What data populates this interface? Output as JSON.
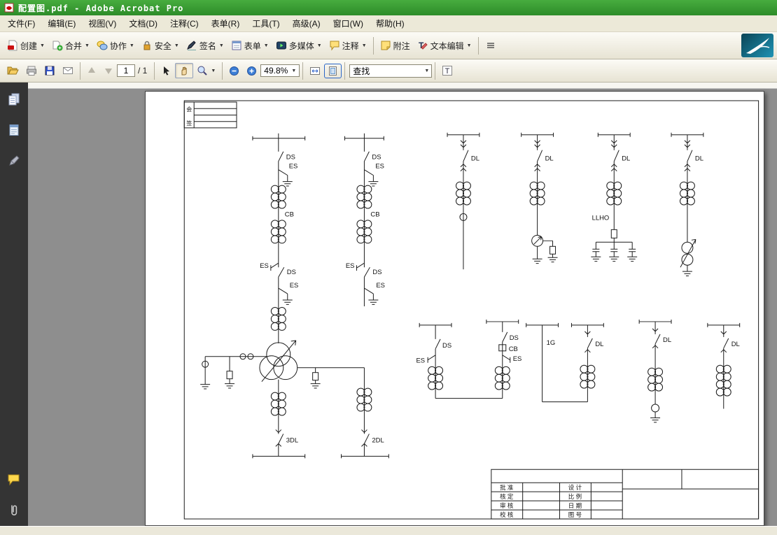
{
  "window": {
    "title": "配置图.pdf - Adobe Acrobat Pro"
  },
  "menubar": {
    "items": [
      "文件(F)",
      "编辑(E)",
      "视图(V)",
      "文档(D)",
      "注释(C)",
      "表单(R)",
      "工具(T)",
      "高级(A)",
      "窗口(W)",
      "帮助(H)"
    ]
  },
  "toolbar_main": {
    "create": "创建",
    "combine": "合并",
    "collaborate": "协作",
    "secure": "安全",
    "sign": "签名",
    "forms": "表单",
    "multimedia": "多媒体",
    "comment": "注释",
    "sticky_note": "附注",
    "text_edits": "文本编辑"
  },
  "toolbar_nav": {
    "page_value": "1",
    "page_total": "/ 1",
    "zoom_value": "49.8%",
    "find_value": "查找"
  },
  "document": {
    "huiqian": {
      "col_top": "会",
      "col_bottom": "签"
    },
    "labels": {
      "DS": "DS",
      "ES": "ES",
      "CB": "CB",
      "DL": "DL",
      "LLHO": "LLHO",
      "G1": "1G",
      "DL3": "3DL",
      "DL2": "2DL"
    },
    "title_block": {
      "left_rows": [
        "批 准",
        "核 定",
        "审 核",
        "校 核"
      ],
      "right_rows": [
        "设 计",
        "比 例",
        "日 期",
        "图 号"
      ]
    }
  }
}
